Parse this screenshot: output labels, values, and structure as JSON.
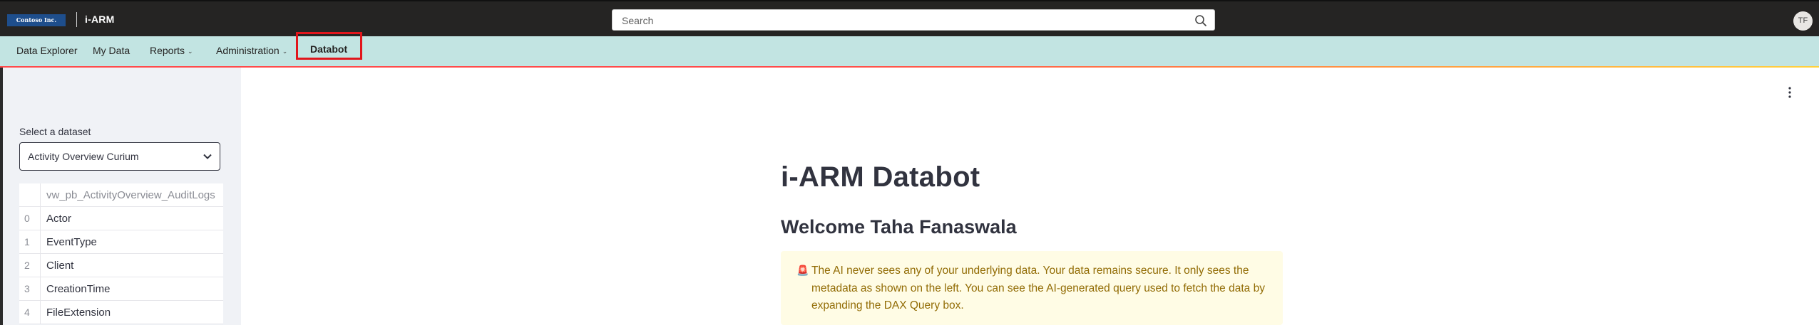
{
  "header": {
    "logo_text": "Contoso Inc.",
    "app_title": "i-ARM",
    "search_placeholder": "Search",
    "user_initials": "TF"
  },
  "nav": {
    "items": [
      {
        "label": "Data Explorer",
        "has_dropdown": false
      },
      {
        "label": "My Data",
        "has_dropdown": false
      },
      {
        "label": "Reports",
        "has_dropdown": true
      },
      {
        "label": "Administration",
        "has_dropdown": true
      },
      {
        "label": "Databot",
        "has_dropdown": false,
        "active": true
      }
    ],
    "chevron": "⌄"
  },
  "sidebar": {
    "select_label": "Select a dataset",
    "select_value": "Activity Overview Curium",
    "table": {
      "column_header": "vw_pb_ActivityOverview_AuditLogs",
      "rows": [
        {
          "index": "0",
          "value": "Actor"
        },
        {
          "index": "1",
          "value": "EventType"
        },
        {
          "index": "2",
          "value": "Client"
        },
        {
          "index": "3",
          "value": "CreationTime"
        },
        {
          "index": "4",
          "value": "FileExtension"
        }
      ]
    }
  },
  "main": {
    "title": "i-ARM Databot",
    "welcome": "Welcome Taha Fanaswala",
    "alert": {
      "icon": "🚨",
      "text": "The AI never sees any of your underlying data. Your data remains secure. It only sees the metadata as shown on the left. You can see the AI-generated query used to fetch the data by expanding the DAX Query box."
    }
  },
  "colors": {
    "topbar": "#252423",
    "navbar": "#c2e4e2",
    "active_outline": "#e1151b",
    "sidebar": "#f0f2f6",
    "alert_bg": "#fffce5",
    "alert_text": "#926c05"
  }
}
